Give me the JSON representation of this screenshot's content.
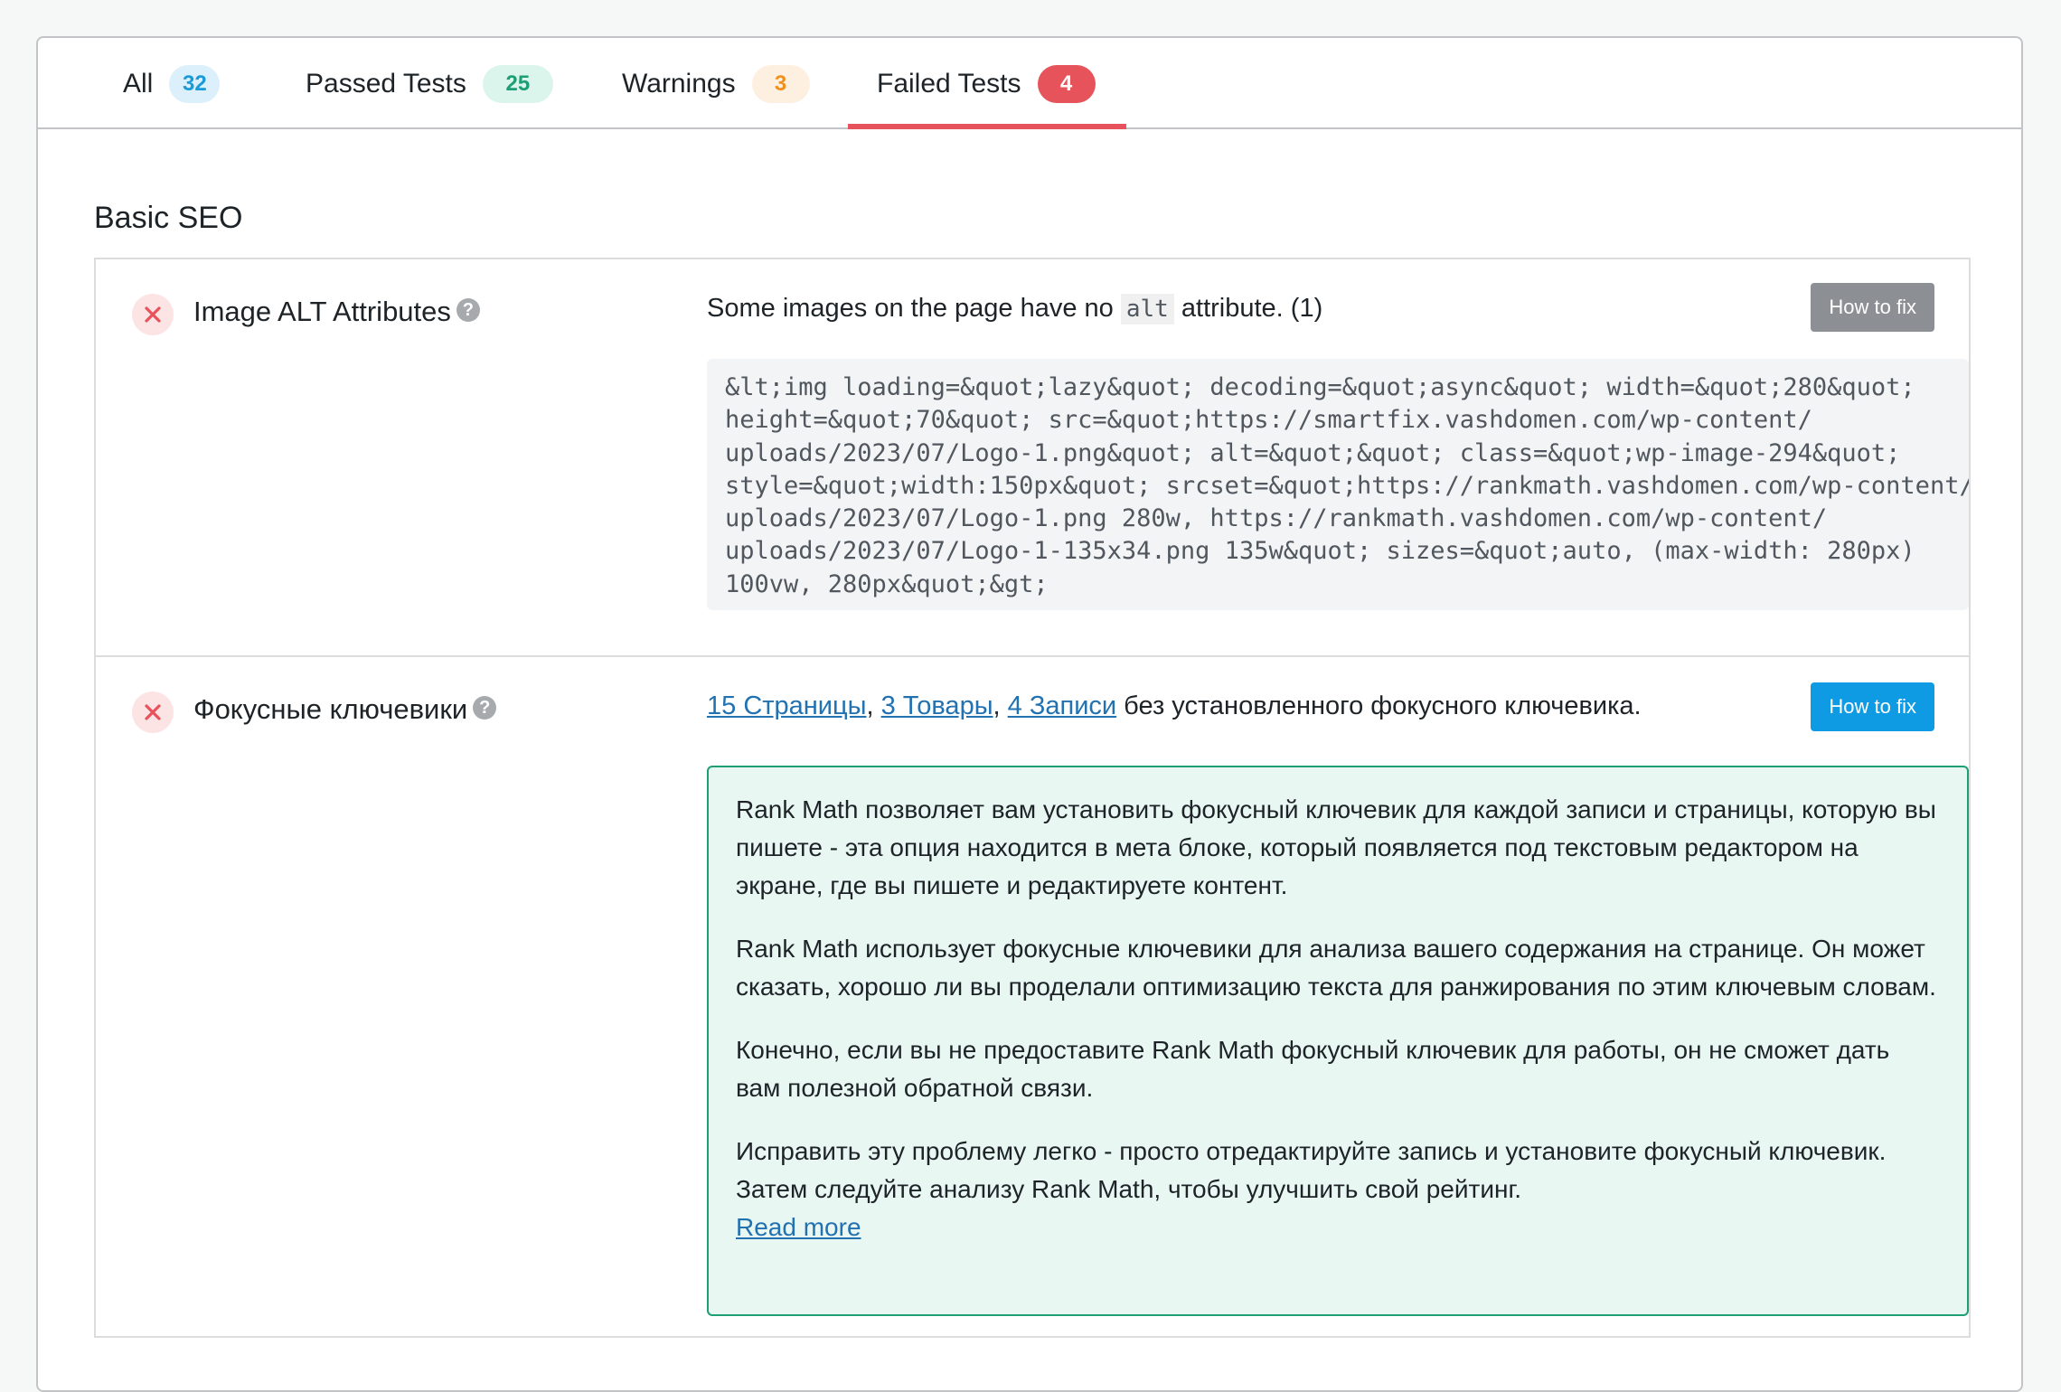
{
  "tabs": [
    {
      "label": "All",
      "count": "32"
    },
    {
      "label": "Passed Tests",
      "count": "25"
    },
    {
      "label": "Warnings",
      "count": "3"
    },
    {
      "label": "Failed Tests",
      "count": "4"
    }
  ],
  "active_tab": "Failed Tests",
  "section": {
    "title": "Basic SEO"
  },
  "tests": [
    {
      "status": "failed",
      "label": "Image ALT Attributes",
      "help_glyph": "?",
      "result_prefix": "Some images on the page have no ",
      "result_code": "alt",
      "result_suffix": " attribute. (1)",
      "code_lines": [
        "&lt;img loading=&quot;lazy&quot; decoding=&quot;async&quot; width=&quot;280&quot;",
        "height=&quot;70&quot; src=&quot;https://smartfix.vashdomen.com/wp-content/",
        "uploads/2023/07/Logo-1.png&quot; alt=&quot;&quot; class=&quot;wp-image-294&quot;",
        "style=&quot;width:150px&quot; srcset=&quot;https://rankmath.vashdomen.com/wp-content/",
        "uploads/2023/07/Logo-1.png 280w, https://rankmath.vashdomen.com/wp-content/",
        "uploads/2023/07/Logo-1-135x34.png 135w&quot; sizes=&quot;auto, (max-width: 280px)",
        "100vw, 280px&quot;&gt;"
      ],
      "button_label": "How to fix"
    },
    {
      "status": "failed",
      "label": "Фокусные ключевики",
      "help_glyph": "?",
      "links": [
        "15 Страницы",
        "3 Товары",
        "4 Записи"
      ],
      "separator": ", ",
      "result_suffix": " без установленного фокусного ключевика.",
      "button_label": "How to fix",
      "info_paragraphs": [
        "Rank Math позволяет вам установить фокусный ключевик для каждой записи и страницы, которую вы пишете - эта опция находится в мета блоке, который появляется под текстовым редактором на экране, где вы пишете и редактируете контент.",
        "Rank Math использует фокусные ключевики для анализа вашего содержания на странице. Он может сказать, хорошо ли вы проделали оптимизацию текста для ранжирования по этим ключевым словам.",
        "Конечно, если вы не предоставите Rank Math фокусный ключевик для работы, он не сможет дать вам полезной обратной связи.",
        "Исправить эту проблему легко - просто отредактируйте запись и установите фокусный ключевик. Затем следуйте анализу Rank Math, чтобы улучшить свой рейтинг."
      ],
      "read_more": "Read more"
    }
  ],
  "colors": {
    "fail": "#e6535b",
    "fail_bg": "#fde4e4",
    "info_border": "#1d9e75",
    "info_bg": "#e9f7f3",
    "button_gray": "#8c8f94",
    "button_blue": "#0f9be3",
    "link": "#2271b1"
  },
  "icons": {
    "status": "close-x-icon",
    "help": "question-circle-icon"
  }
}
